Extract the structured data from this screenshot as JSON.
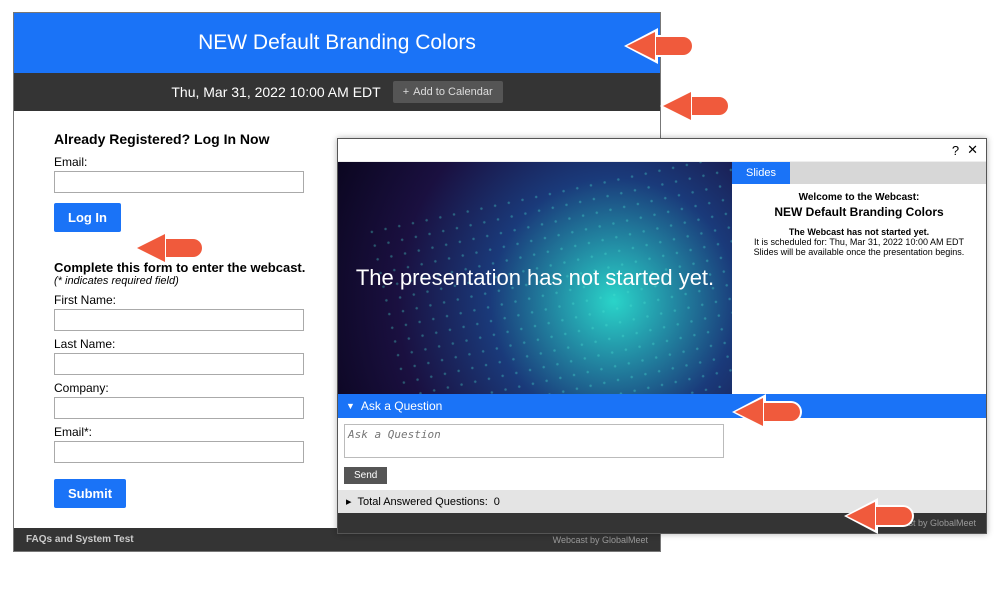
{
  "colors": {
    "primary": "#1a73f7",
    "dark": "#343434"
  },
  "reg": {
    "title": "NEW Default Branding Colors",
    "datetime": "Thu, Mar 31, 2022 10:00 AM EDT",
    "add_calendar": "Add to Calendar",
    "already": "Already Registered? Log In Now",
    "email_label": "Email:",
    "login": "Log In",
    "form_intro": "Complete this form to enter the webcast.",
    "form_note": "(* indicates required field)",
    "first_name": "First Name:",
    "last_name": "Last Name:",
    "company": "Company:",
    "email_req": "Email*:",
    "submit": "Submit",
    "faq": "FAQs and System Test",
    "powered": "Webcast by  GlobalMeet"
  },
  "player": {
    "help": "?",
    "close": "✕",
    "video_text": "The presentation has not started yet.",
    "tab_slides": "Slides",
    "welcome": "Welcome to the Webcast:",
    "title": "NEW Default Branding Colors",
    "status": "The Webcast has not started yet.",
    "sched": "It is scheduled for: Thu, Mar 31, 2022 10:00 AM EDT",
    "slides_msg": "Slides will be available once the presentation begins.",
    "ask_header": "Ask a Question",
    "ask_placeholder": "Ask a Question",
    "send": "Send",
    "answered_label": "Total Answered Questions:",
    "answered_count": "0",
    "powered": "Webcast by  GlobalMeet"
  }
}
